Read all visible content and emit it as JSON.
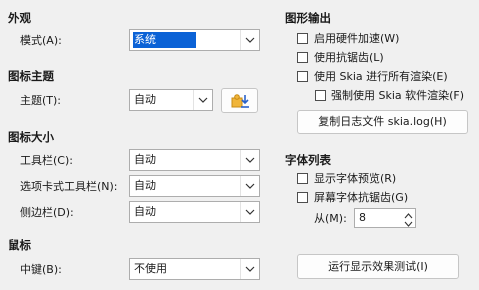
{
  "appearance": {
    "header": "外观",
    "mode_label": "模式(A):",
    "mode_value": "系统"
  },
  "icon_theme": {
    "header": "图标主题",
    "theme_label": "主题(T):",
    "theme_value": "自动"
  },
  "icon_size": {
    "header": "图标大小",
    "toolbar_label": "工具栏(C):",
    "toolbar_value": "自动",
    "tabbed_label": "选项卡式工具栏(N):",
    "tabbed_value": "自动",
    "sidebar_label": "侧边栏(D):",
    "sidebar_value": "自动"
  },
  "mouse": {
    "header": "鼠标",
    "middle_label": "中键(B):",
    "middle_value": "不使用"
  },
  "graphics": {
    "header": "图形输出",
    "hw_accel": "启用硬件加速(W)",
    "antialias": "使用抗锯齿(L)",
    "skia_all": "使用 Skia 进行所有渲染(E)",
    "skia_sw": "强制使用 Skia 软件渲染(F)",
    "copy_log_button": "复制日志文件 skia.log(H)"
  },
  "font_list": {
    "header": "字体列表",
    "show_preview": "显示字体预览(R)",
    "screen_aa": "屏幕字体抗锯齿(G)",
    "from_label": "从(M):",
    "from_value": "8"
  },
  "run_test_button": "运行显示效果测试(I)",
  "colors": {
    "selection": "#0b62d6",
    "background": "#f0f0f0"
  }
}
